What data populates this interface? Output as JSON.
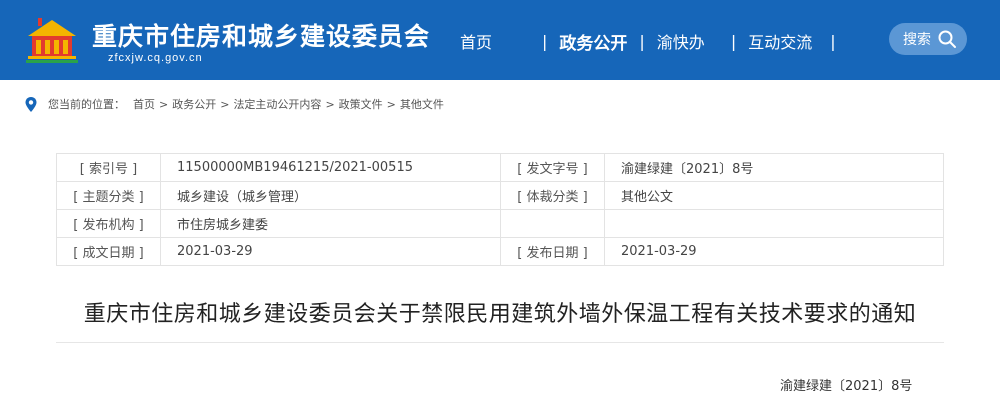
{
  "header": {
    "site_title": "重庆市住房和城乡建设委员会",
    "site_domain": "zfcxjw.cq.gov.cn",
    "brand_color": "#1666b9",
    "nav": [
      {
        "label": "首页",
        "active": false
      },
      {
        "label": "政务公开",
        "active": true
      },
      {
        "label": "渝快办",
        "active": false
      },
      {
        "label": "互动交流",
        "active": false
      }
    ],
    "search_label": "搜索",
    "search_icon": "search-icon",
    "logo_icon": "government-emblem-logo"
  },
  "breadcrumb": {
    "icon": "location-pin-icon",
    "prefix": "您当前的位置：",
    "items": [
      "首页",
      "政务公开",
      "法定主动公开内容",
      "政策文件",
      "其他文件"
    ],
    "separator": ">"
  },
  "meta": {
    "index_no_label": "[ 索引号 ]",
    "index_no": "11500000MB19461215/2021-00515",
    "doc_no_label": "[ 发文字号 ]",
    "doc_no": "渝建绿建〔2021〕8号",
    "topic_label": "[ 主题分类 ]",
    "topic": "城乡建设（城乡管理）",
    "genre_label": "[ 体裁分类 ]",
    "genre": "其他公文",
    "issuer_label": "[ 发布机构 ]",
    "issuer": "市住房城乡建委",
    "created_label": "[ 成文日期 ]",
    "created": "2021-03-29",
    "published_label": "[ 发布日期 ]",
    "published": "2021-03-29"
  },
  "document": {
    "title": "重庆市住房和城乡建设委员会关于禁限民用建筑外墙外保温工程有关技术要求的通知",
    "number": "渝建绿建〔2021〕8号"
  }
}
